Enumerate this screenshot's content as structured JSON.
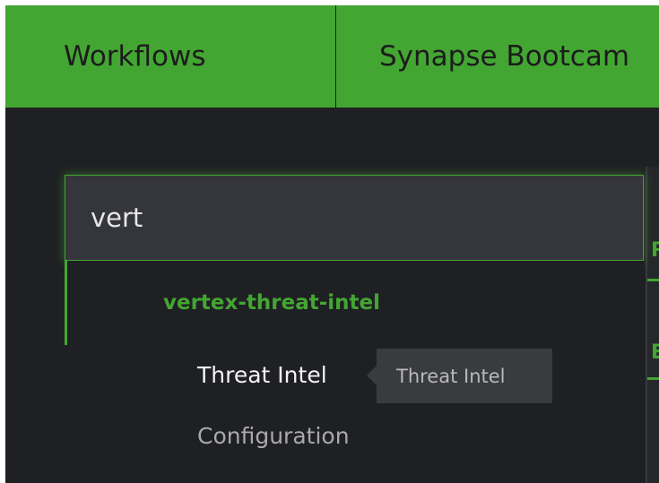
{
  "topbar": {
    "tabs": [
      {
        "label": "Workflows"
      },
      {
        "label": "Synapse Bootcam"
      }
    ]
  },
  "search": {
    "value": "vert"
  },
  "results": {
    "group_label": "vertex-threat-intel",
    "items": [
      {
        "label": "Threat Intel"
      },
      {
        "label": "Configuration"
      }
    ]
  },
  "tooltip": {
    "text": "Threat Intel"
  },
  "background_fragments": [
    "R",
    "E"
  ],
  "colors": {
    "accent": "#43a632",
    "background": "#1f2023",
    "input_bg": "#35363c"
  }
}
